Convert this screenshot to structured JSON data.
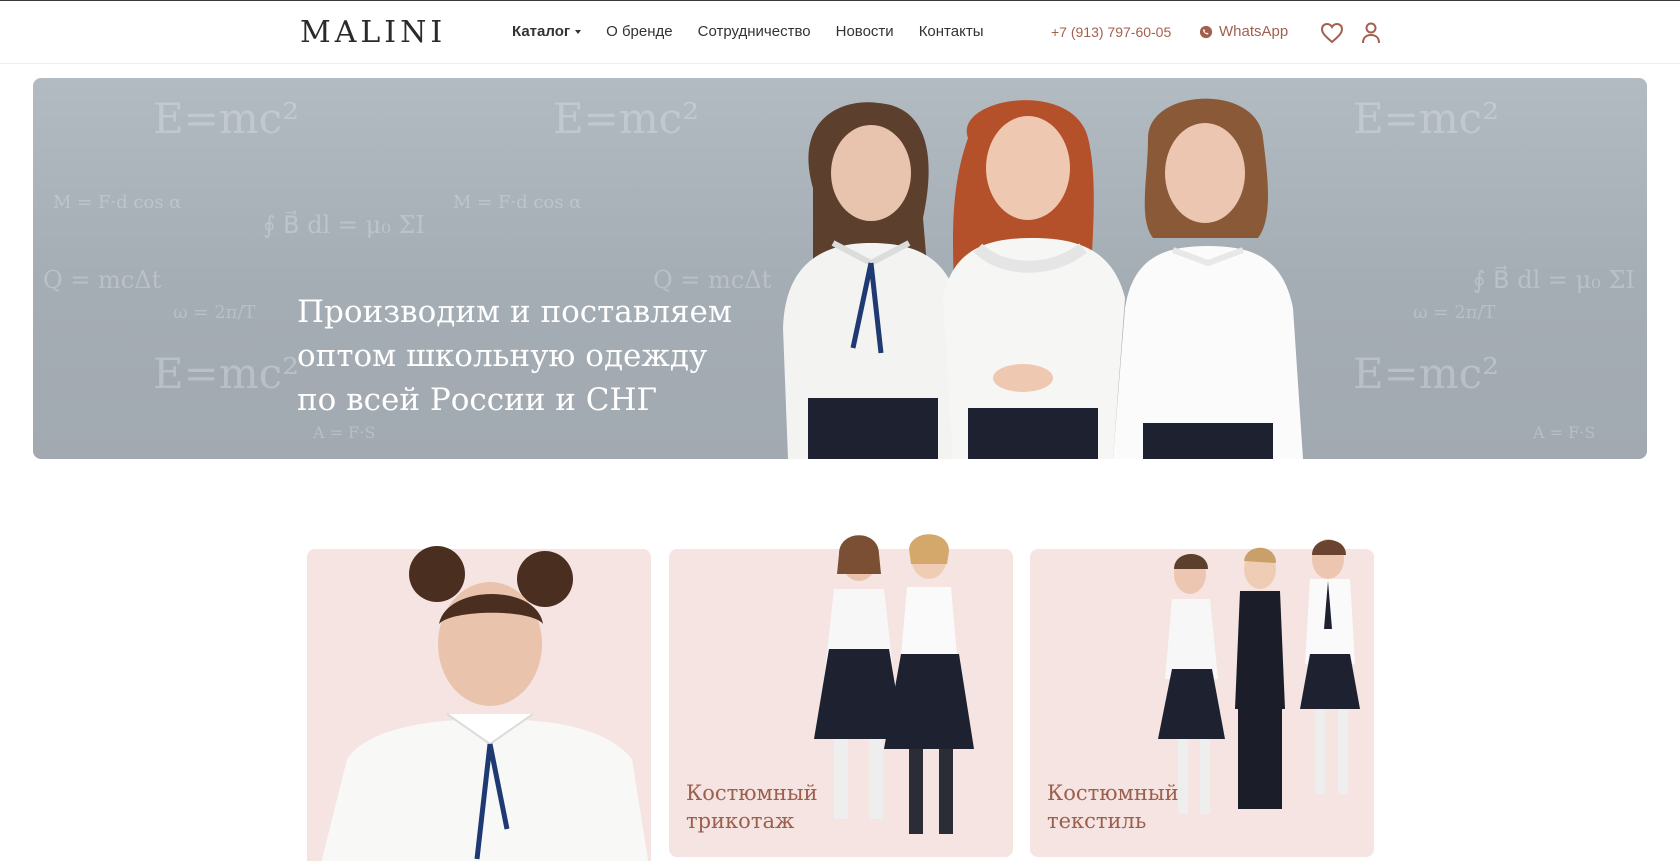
{
  "header": {
    "logo": "MALINI",
    "nav": [
      {
        "label": "Каталог"
      },
      {
        "label": "О бренде"
      },
      {
        "label": "Сотрудничество"
      },
      {
        "label": "Новости"
      },
      {
        "label": "Контакты"
      }
    ],
    "phone": "+7 (913) 797-60-05",
    "whatsapp": "WhatsApp",
    "icons": {
      "favorites": "heart-icon",
      "account": "user-icon",
      "whatsapp": "whatsapp-icon"
    }
  },
  "hero": {
    "title_lines": [
      "Производим и поставляем",
      "оптом школьную одежду",
      "по всей России и СНГ"
    ]
  },
  "cards": [
    {
      "label": ""
    },
    {
      "label": "Костюмный\nтрикотаж"
    },
    {
      "label": "Костюмный\nтекстиль"
    }
  ],
  "colors": {
    "accent": "#a35f4e",
    "card_bg": "#f5e4e2",
    "hero_bg": "#a9b1b9"
  }
}
